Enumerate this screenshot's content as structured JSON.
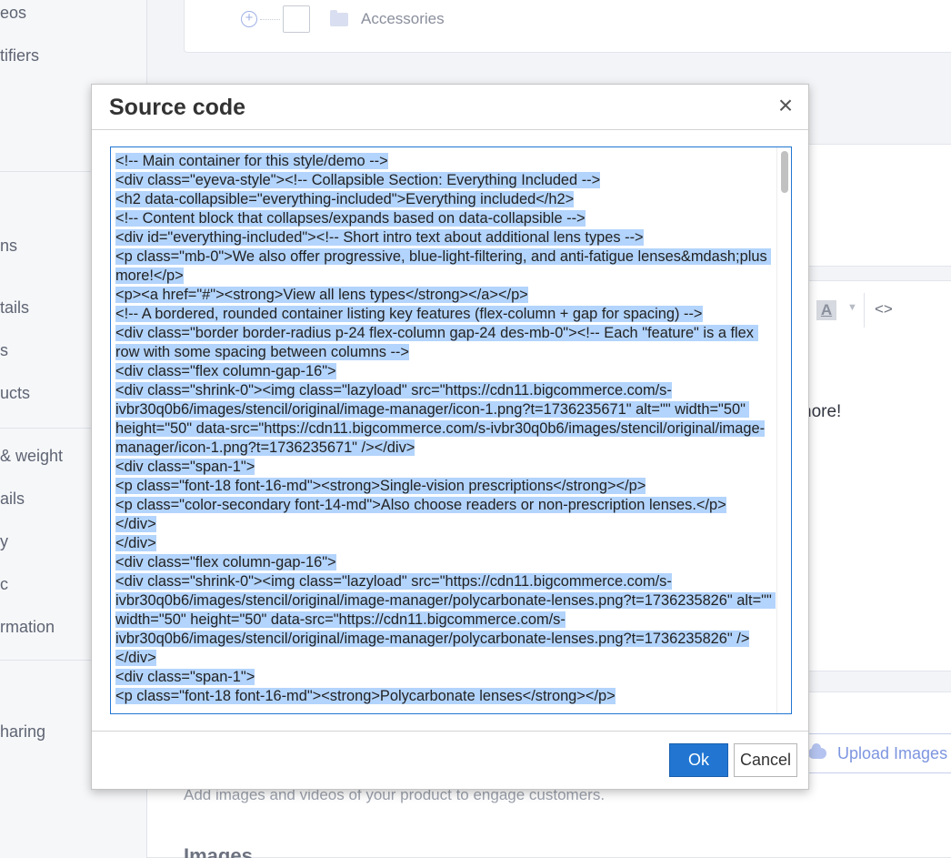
{
  "sidebar": {
    "items": [
      "eos",
      "tifiers",
      "ns",
      "tails",
      "s",
      "ucts",
      "& weight",
      "ails",
      "y",
      "c",
      "rmation",
      "haring"
    ]
  },
  "categories": {
    "row_label": "Accessories"
  },
  "editor": {
    "visible_text": "nore!",
    "toolbar_font_color_label": "A"
  },
  "media": {
    "upload_label": "Upload Images",
    "hint": "Add images and videos of your product to engage customers.",
    "images_heading": "Images"
  },
  "modal": {
    "title": "Source code",
    "close_label": "×",
    "ok_label": "Ok",
    "cancel_label": "Cancel",
    "source_lines": [
      "<!-- Main container for this style/demo -->",
      "<div class=\"eyeva-style\"><!-- Collapsible Section: Everything Included -->",
      "<h2 data-collapsible=\"everything-included\">Everything included</h2>",
      "<!-- Content block that collapses/expands based on data-collapsible -->",
      "<div id=\"everything-included\"><!-- Short intro text about additional lens types -->",
      "<p class=\"mb-0\">We also offer progressive, blue-light-filtering, and anti-fatigue lenses&mdash;plus more!</p>",
      "<p><a href=\"#\"><strong>View all lens types</strong></a></p>",
      "<!-- A bordered, rounded container listing key features (flex-column + gap for spacing) -->",
      "<div class=\"border border-radius p-24 flex-column gap-24 des-mb-0\"><!-- Each \"feature\" is a flex row with some spacing between columns -->",
      "<div class=\"flex column-gap-16\">",
      "<div class=\"shrink-0\"><img class=\"lazyload\" src=\"https://cdn11.bigcommerce.com/s-ivbr30q0b6/images/stencil/original/image-manager/icon-1.png?t=1736235671\" alt=\"\" width=\"50\" height=\"50\" data-src=\"https://cdn11.bigcommerce.com/s-ivbr30q0b6/images/stencil/original/image-manager/icon-1.png?t=1736235671\" /></div>",
      "<div class=\"span-1\">",
      "<p class=\"font-18 font-16-md\"><strong>Single-vision prescriptions</strong></p>",
      "<p class=\"color-secondary font-14-md\">Also choose readers or non-prescription lenses.</p>",
      "</div>",
      "</div>",
      "<div class=\"flex column-gap-16\">",
      "<div class=\"shrink-0\"><img class=\"lazyload\" src=\"https://cdn11.bigcommerce.com/s-ivbr30q0b6/images/stencil/original/image-manager/polycarbonate-lenses.png?t=1736235826\" alt=\"\" width=\"50\" height=\"50\" data-src=\"https://cdn11.bigcommerce.com/s-ivbr30q0b6/images/stencil/original/image-manager/polycarbonate-lenses.png?t=1736235826\" /></div>",
      "<div class=\"span-1\">",
      "<p class=\"font-18 font-16-md\"><strong>Polycarbonate lenses</strong></p>"
    ]
  },
  "colors": {
    "primary": "#2276d2",
    "selection": "#b3d4fc",
    "link": "#7d95e0"
  }
}
